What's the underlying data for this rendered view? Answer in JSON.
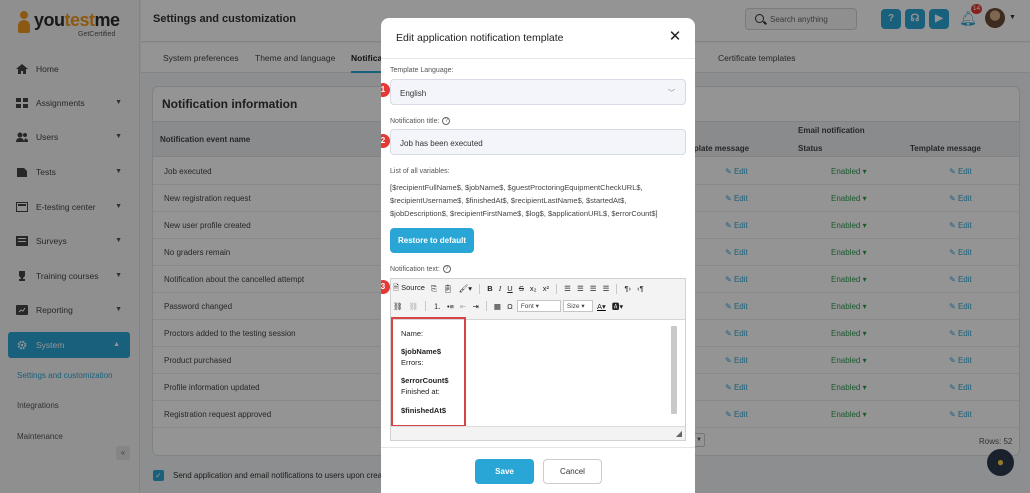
{
  "brand": {
    "name_left": "you",
    "name_mid": "test",
    "name_right": "me",
    "sub": "GetCertified",
    "accent": "#2aa6d6",
    "logo_color": "#f29a1f"
  },
  "sidebar": {
    "items": [
      {
        "label": "Home",
        "icon": "home-icon"
      },
      {
        "label": "Assignments",
        "icon": "assignments-icon"
      },
      {
        "label": "Users",
        "icon": "users-icon"
      },
      {
        "label": "Tests",
        "icon": "tests-icon"
      },
      {
        "label": "E-testing center",
        "icon": "e-testing-icon"
      },
      {
        "label": "Surveys",
        "icon": "surveys-icon"
      },
      {
        "label": "Training courses",
        "icon": "trophy-icon"
      },
      {
        "label": "Reporting",
        "icon": "reporting-icon"
      },
      {
        "label": "System",
        "icon": "gear-icon"
      }
    ],
    "subitems": [
      "Settings and customization",
      "Integrations",
      "Maintenance"
    ],
    "collapse": "«"
  },
  "header": {
    "title": "Settings and customization",
    "search_placeholder": "Search anything",
    "notification_count": "14"
  },
  "tabs": [
    "System preferences",
    "Theme and language",
    "Notificat",
    "Certificate templates"
  ],
  "card": {
    "title": "Notification information",
    "col_event": "Notification event name",
    "col_template_message_partial": "nplate message",
    "group_email": "Email notification",
    "col_status": "Status",
    "col_template_message": "Template message",
    "rows": [
      {
        "event": "Job executed",
        "status": "Enabled"
      },
      {
        "event": "New registration request",
        "status": "Enabled"
      },
      {
        "event": "New user profile created",
        "status": "Enabled"
      },
      {
        "event": "No graders remain",
        "status": "Enabled"
      },
      {
        "event": "Notification about the cancelled attempt",
        "status": "Enabled"
      },
      {
        "event": "Password changed",
        "status": "Enabled"
      },
      {
        "event": "Proctors added to the testing session",
        "status": "Enabled"
      },
      {
        "event": "Product purchased",
        "status": "Enabled"
      },
      {
        "event": "Profile information updated",
        "status": "Enabled"
      },
      {
        "event": "Registration request approved",
        "status": "Enabled"
      }
    ],
    "edit_label": "Edit",
    "rows_label": "Rows: 52"
  },
  "bottom": {
    "checkbox_label": "Send application and email notifications to users upon creatio"
  },
  "modal": {
    "title": "Edit application notification template",
    "language_label": "Template Language:",
    "language_value": "English",
    "title_label": "Notification title:",
    "title_value": "Job has been executed",
    "vars_label": "List of all variables:",
    "vars_lines": [
      "[$recipientFullName$, $jobName$, $guestProctoringEquipmentCheckURL$,",
      "$recipientUsername$, $finishedAt$, $recipientLastName$, $startedAt$,",
      "$jobDescription$, $recipientFirstName$, $log$, $applicationURL$, $errorCount$]"
    ],
    "restore_label": "Restore to default",
    "text_label": "Notification text:",
    "toolbar": {
      "source": "Source",
      "font": "Font",
      "size": "Size"
    },
    "content": [
      "Name:",
      "$jobName$",
      "Errors:",
      "$errorCount$",
      "Finished at:",
      "$finishedAt$"
    ],
    "steps": [
      "1",
      "2",
      "3"
    ],
    "save_label": "Save",
    "cancel_label": "Cancel"
  }
}
